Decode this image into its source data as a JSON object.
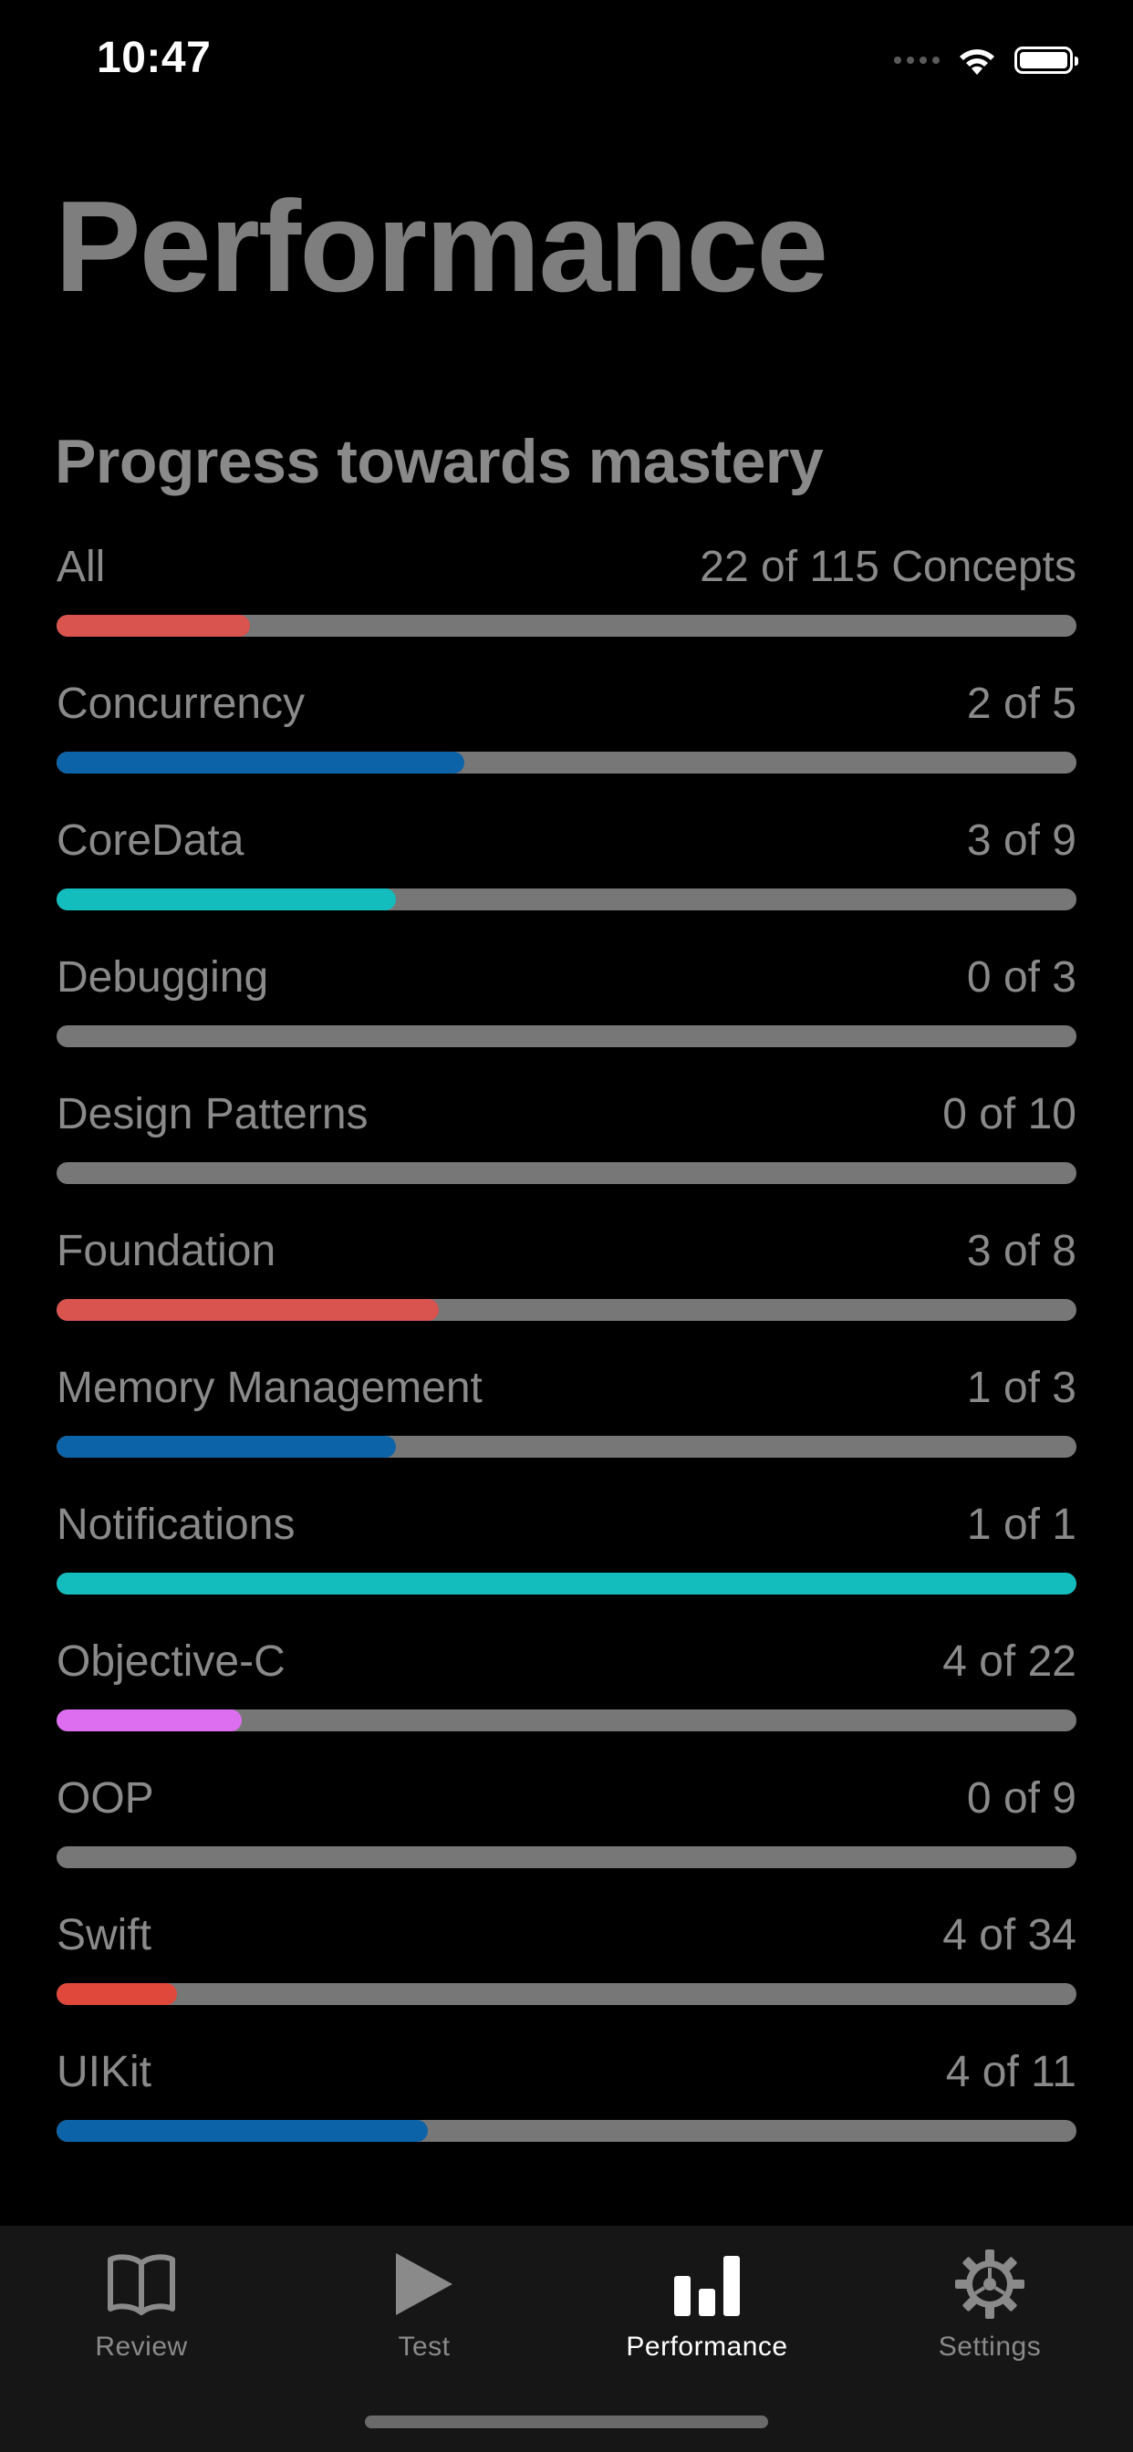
{
  "status_bar": {
    "time": "10:47"
  },
  "page_title": "Performance",
  "section_title": "Progress towards mastery",
  "progress": [
    {
      "name": "All",
      "count": "22 of 115 Concepts",
      "fraction": 0.19,
      "color": "#d9534f"
    },
    {
      "name": "Concurrency",
      "count": "2 of 5",
      "fraction": 0.4,
      "color": "#0d63a8"
    },
    {
      "name": "CoreData",
      "count": "3 of 9",
      "fraction": 0.333,
      "color": "#13bdbd"
    },
    {
      "name": "Debugging",
      "count": "0 of 3",
      "fraction": 0.0,
      "color": "#777777"
    },
    {
      "name": "Design Patterns",
      "count": "0 of 10",
      "fraction": 0.0,
      "color": "#777777"
    },
    {
      "name": "Foundation",
      "count": "3 of 8",
      "fraction": 0.375,
      "color": "#d9534f"
    },
    {
      "name": "Memory Management",
      "count": "1 of 3",
      "fraction": 0.333,
      "color": "#0d63a8"
    },
    {
      "name": "Notifications",
      "count": "1 of 1",
      "fraction": 1.0,
      "color": "#13bdbd"
    },
    {
      "name": "Objective-C",
      "count": "4 of 22",
      "fraction": 0.182,
      "color": "#dd6ef0"
    },
    {
      "name": "OOP",
      "count": "0 of 9",
      "fraction": 0.0,
      "color": "#777777"
    },
    {
      "name": "Swift",
      "count": "4 of 34",
      "fraction": 0.118,
      "color": "#e0483c"
    },
    {
      "name": "UIKit",
      "count": "4 of 11",
      "fraction": 0.364,
      "color": "#0d63a8"
    }
  ],
  "tabs": [
    {
      "label": "Review",
      "icon": "book-icon",
      "active": false
    },
    {
      "label": "Test",
      "icon": "play-icon",
      "active": false
    },
    {
      "label": "Performance",
      "icon": "bar-chart-icon",
      "active": true
    },
    {
      "label": "Settings",
      "icon": "gear-icon",
      "active": false
    }
  ]
}
